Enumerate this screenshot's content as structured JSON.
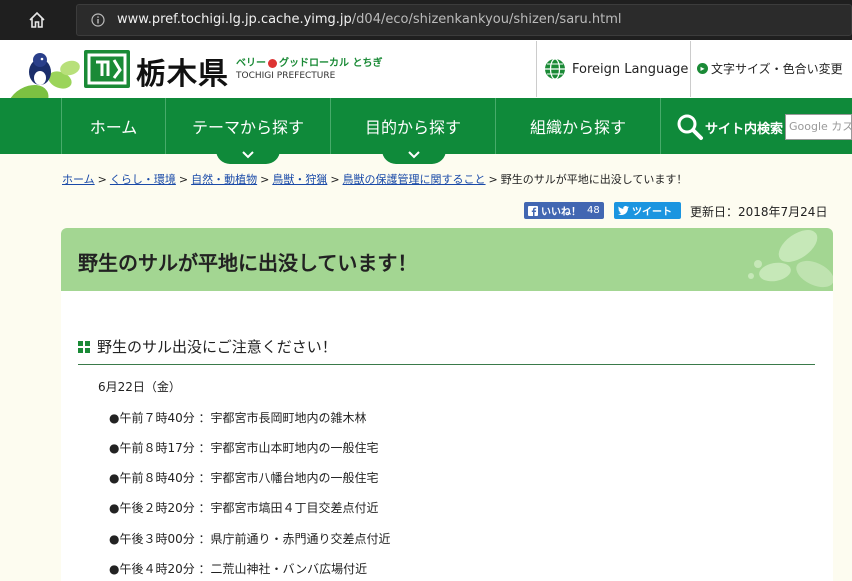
{
  "browser": {
    "url_host": "www.pref.tochigi.lg.jp.cache.yimg.jp",
    "url_path": "/d04/eco/shizenkankyou/shizen/saru.html"
  },
  "header": {
    "logo_text": "栃木県",
    "tagline_left": "ベリー",
    "tagline_right": "グッドローカル とちぎ",
    "tagline_en": "TOCHIGI PREFECTURE",
    "foreign_language": "Foreign Language",
    "font_size_label": "文字サイズ・色合い変更"
  },
  "nav": {
    "home": "ホーム",
    "theme": "テーマから探す",
    "purpose": "目的から探す",
    "org": "組織から探す",
    "search_label": "サイト内検索",
    "search_placeholder": "Google カスタ"
  },
  "breadcrumb": {
    "items": [
      "ホーム",
      "くらし・環境",
      "自然・動植物",
      "鳥獣・狩猟",
      "鳥獣の保護管理に関すること"
    ],
    "current": "野生のサルが平地に出没しています！"
  },
  "social": {
    "like_label": "いいね！",
    "like_count": "48",
    "tweet_label": "ツイート",
    "updated": "更新日：2018年7月24日"
  },
  "content": {
    "title": "野生のサルが平地に出没しています！",
    "section_title": "野生のサル出没にご注意ください！",
    "date": "6月22日（金）",
    "sightings": [
      "●午前７時40分 ：宇都宮市長岡町地内の雑木林",
      "●午前８時17分 ：宇都宮市山本町地内の一般住宅",
      "●午前８時40分 ：宇都宮市八幡台地内の一般住宅",
      "●午後２時20分 ：宇都宮市塙田４丁目交差点付近",
      "●午後３時00分 ：県庁前通り・赤門通り交差点付近",
      "●午後４時20分 ：二荒山神社・バンバ広場付近"
    ]
  },
  "colors": {
    "nav_green": "#0f8a3a",
    "title_green": "#a3d692",
    "link_blue": "#1a4aa8"
  }
}
